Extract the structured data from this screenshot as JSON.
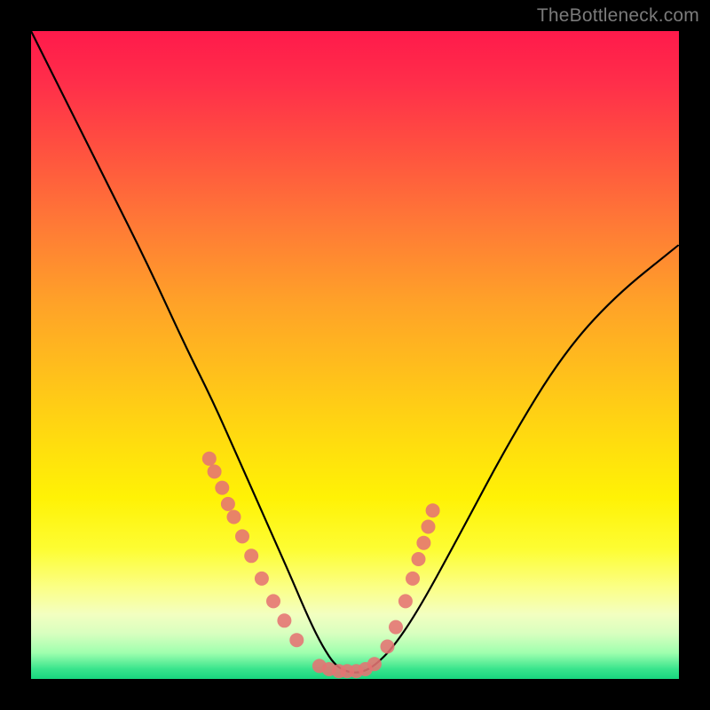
{
  "watermark": "TheBottleneck.com",
  "colors": {
    "dot": "#e57373",
    "curve": "#000000",
    "frame": "#000000"
  },
  "chart_data": {
    "type": "line",
    "title": "",
    "xlabel": "",
    "ylabel": "",
    "xlim": [
      0,
      100
    ],
    "ylim": [
      0,
      100
    ],
    "grid": false,
    "legend": false,
    "note": "No numeric axis ticks are rendered; values below are normalized 0–100 estimates read from pixel positions (x left→right, y bottom→top).",
    "series": [
      {
        "name": "bottleneck-curve",
        "type": "line",
        "x": [
          0,
          6,
          12,
          18,
          24,
          28,
          32,
          36,
          40,
          43,
          45,
          47,
          49,
          51,
          53,
          56,
          60,
          66,
          74,
          82,
          90,
          100
        ],
        "y": [
          100,
          88,
          76,
          64,
          51,
          43,
          34,
          25,
          16,
          9,
          5,
          2,
          1,
          1,
          2,
          5,
          11,
          22,
          37,
          50,
          59,
          67
        ]
      },
      {
        "name": "highlight-dots",
        "type": "scatter",
        "x": [
          27.5,
          28.3,
          29.5,
          30.4,
          31.3,
          32.6,
          34.0,
          35.6,
          37.4,
          39.1,
          41.0,
          44.5,
          46.0,
          47.5,
          48.8,
          50.2,
          51.6,
          53.0,
          55.0,
          56.3,
          57.8,
          58.9,
          59.8,
          60.6,
          61.3,
          62.0
        ],
        "y": [
          34.0,
          32.0,
          29.5,
          27.0,
          25.0,
          22.0,
          19.0,
          15.5,
          12.0,
          9.0,
          6.0,
          2.0,
          1.5,
          1.2,
          1.2,
          1.2,
          1.5,
          2.3,
          5.0,
          8.0,
          12.0,
          15.5,
          18.5,
          21.0,
          23.5,
          26.0
        ]
      }
    ]
  }
}
